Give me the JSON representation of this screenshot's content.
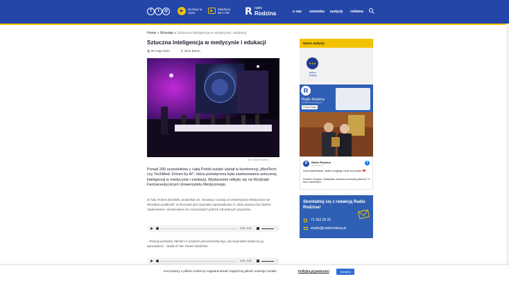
{
  "colors": {
    "header_bg": "#2346a8",
    "accent": "#f2c200",
    "panel_blue": "#2f5fb4",
    "cookie_button": "#2f6fd6"
  },
  "header": {
    "social_icons": [
      "facebook-icon",
      "twitter-icon",
      "instagram-icon"
    ],
    "social_glyphs": [
      "f",
      "t",
      "◎"
    ],
    "listen_label": "słuchaj na żywo",
    "frequency_label": "Świdnica 96.1 FM",
    "logo_prefix": "radio",
    "logo_name": "Rodzina",
    "nav": [
      "o nas",
      "ramówka",
      "audycje",
      "reklama"
    ]
  },
  "breadcrumb": {
    "home": "Home",
    "sep1": "»",
    "category": "Wrocław",
    "sep2": "»",
    "current": "Sztuczna inteligencja w medycynie i edukacji"
  },
  "article": {
    "title": "Sztuczna inteligencja w medycynie i edukacji",
    "date": "28 maja 2024",
    "author": "Ilona Baran",
    "photo_caption": "fot. Radio Rodzina",
    "lead": "Ponad 200 uczestników z całej Polski wzięło udział w konferencji „MedTech czy TechMed. Driven by AI\", która poświęcona była zastosowaniu sztucznej inteligencji w medycynie i edukacji. Wydarzenie odbyło się na Wydziale Farmaceutycznym Uniwersytetu Medycznego.",
    "paragraph1": "Dr hab. Robert Żymliński, prodziekan ds. innowacji i rozwoju w Uniwersytecie Medycznym we Wrocławiu podkreślił, że kluczowe jest racjonalne wprowadzanie AI, które powinno być dobrze zaplanowane i dostosowane do rzeczywistych potrzeb zdrowotnych pacjentów.",
    "paragraph2": "– Relacja pomiędzy zaletami a ryzykiem jest pochodną tego, jak racjonalnie będziemy ją wprowadzać – dodał dr hab. Robert Żymliński."
  },
  "audio": [
    {
      "time": "0:00 / 0:00"
    },
    {
      "time": "0:00 / 0:00"
    }
  ],
  "sidebar": {
    "tab_label": "Nasze audycje",
    "program_name": "wiersz audycji",
    "fb_page": {
      "name": "Radio Rodzina",
      "followers": "13 000 obserwujących",
      "follow_label": "Follow Page"
    },
    "fb_post": {
      "name": "Radio Rodzina",
      "time": "20 min temu",
      "text1": "lecia małżeństwa. Jeden drugiego musi zrozumieć ❤️",
      "text2": "Państwo Krystyna i Władysław obchodzą niezwykły jubileusz 70-lecia małżeństwa."
    },
    "contact": {
      "title": "Skontaktuj się z redakcją Radia Rodzina!",
      "phone": "71 322 20 22",
      "email": "studio@radiorodzina.pl"
    }
  },
  "cookie": {
    "text": "Korzystamy z plików cookie by zagwarantować najwyższą jakość naszego portalu",
    "link": "Polityka prywatności",
    "button": "Akceptuj"
  }
}
